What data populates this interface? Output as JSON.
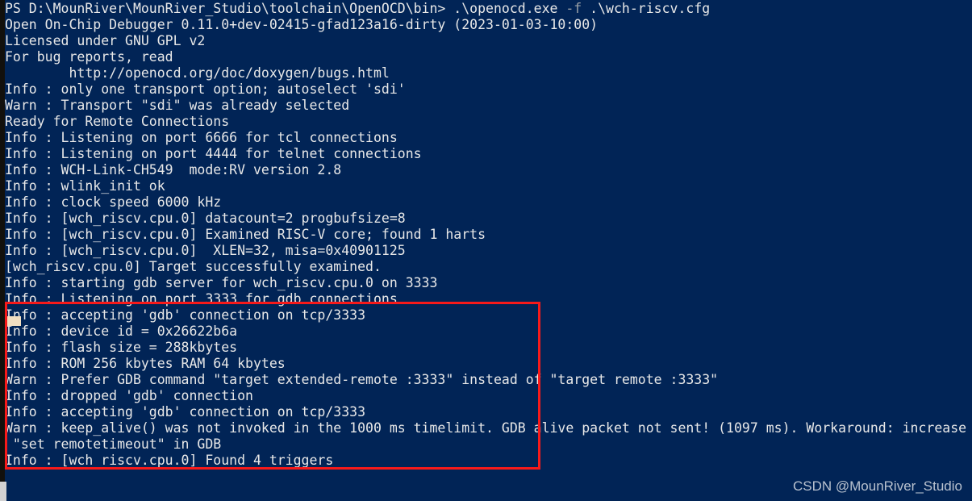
{
  "terminal": {
    "background_color": "#012456",
    "foreground_color": "#e8e8e8",
    "dim_color": "#9aa0a6",
    "prompt": "PS D:\\MounRiver\\MounRiver_Studio\\toolchain\\OpenOCD\\bin>",
    "lines": [
      {
        "id": "line-01",
        "text": "PS D:\\MounRiver\\MounRiver_Studio\\toolchain\\OpenOCD\\bin> .\\openocd.exe ",
        "flag": "-f",
        "text_after": " .\\wch-riscv.cfg"
      },
      {
        "id": "line-02",
        "text": "Open On-Chip Debugger 0.11.0+dev-02415-gfad123a16-dirty (2023-01-03-10:00)"
      },
      {
        "id": "line-03",
        "text": "Licensed under GNU GPL v2"
      },
      {
        "id": "line-04",
        "text": "For bug reports, read"
      },
      {
        "id": "line-05",
        "text": "        http://openocd.org/doc/doxygen/bugs.html"
      },
      {
        "id": "line-06",
        "text": "Info : only one transport option; autoselect 'sdi'"
      },
      {
        "id": "line-07",
        "text": "Warn : Transport \"sdi\" was already selected"
      },
      {
        "id": "line-08",
        "text": "Ready for Remote Connections"
      },
      {
        "id": "line-09",
        "text": "Info : Listening on port 6666 for tcl connections"
      },
      {
        "id": "line-10",
        "text": "Info : Listening on port 4444 for telnet connections"
      },
      {
        "id": "line-11",
        "text": "Info : WCH-Link-CH549  mode:RV version 2.8"
      },
      {
        "id": "line-12",
        "text": "Info : wlink_init ok"
      },
      {
        "id": "line-13",
        "text": "Info : clock speed 6000 kHz"
      },
      {
        "id": "line-14",
        "text": "Info : [wch_riscv.cpu.0] datacount=2 progbufsize=8"
      },
      {
        "id": "line-15",
        "text": "Info : [wch_riscv.cpu.0] Examined RISC-V core; found 1 harts"
      },
      {
        "id": "line-16",
        "text": "Info : [wch_riscv.cpu.0]  XLEN=32, misa=0x40901125"
      },
      {
        "id": "line-17",
        "text": "[wch_riscv.cpu.0] Target successfully examined."
      },
      {
        "id": "line-18",
        "text": "Info : starting gdb server for wch_riscv.cpu.0 on 3333"
      },
      {
        "id": "line-19",
        "text": "Info : Listening on port 3333 for gdb connections"
      },
      {
        "id": "line-20",
        "text": "Info : accepting 'gdb' connection on tcp/3333"
      },
      {
        "id": "line-21",
        "text": "Info : device id = 0x26622b6a"
      },
      {
        "id": "line-22",
        "text": "Info : flash size = 288kbytes"
      },
      {
        "id": "line-23",
        "text": "Info : ROM 256 kbytes RAM 64 kbytes"
      },
      {
        "id": "line-24",
        "text": "Warn : Prefer GDB command \"target extended-remote :3333\" instead of \"target remote :3333\""
      },
      {
        "id": "line-25",
        "text": "Info : dropped 'gdb' connection"
      },
      {
        "id": "line-26",
        "text": "Info : accepting 'gdb' connection on tcp/3333"
      },
      {
        "id": "line-27",
        "text": "Warn : keep_alive() was not invoked in the 1000 ms timelimit. GDB alive packet not sent! (1097 ms). Workaround: increase"
      },
      {
        "id": "line-28",
        "text": " \"set remotetimeout\" in GDB"
      },
      {
        "id": "line-29",
        "text": "Info : [wch_riscv.cpu.0] Found 4 triggers"
      }
    ]
  },
  "annotation": {
    "highlight_box_color": "#f71a1a",
    "gutter_marker_color": "#f2dfc1"
  },
  "watermark": {
    "text": "CSDN @MounRiver_Studio",
    "color": "#b9c2cf"
  }
}
